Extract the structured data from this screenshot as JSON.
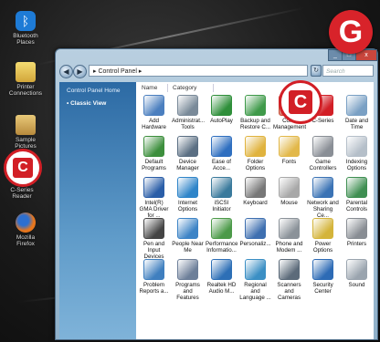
{
  "desktop": {
    "icons": [
      {
        "label": "Bluetooth Places",
        "color": "#1e7bd6"
      },
      {
        "label": "Printer Connections",
        "color": "#e2c048"
      },
      {
        "label": "Sample Pictures",
        "color": "#d7b25a"
      },
      {
        "label": "C-Series Reader",
        "color": "#d21f26"
      },
      {
        "label": "Mozilla Firefox",
        "color": "#e66a1a"
      }
    ]
  },
  "badge": {
    "letter": "G"
  },
  "window": {
    "address": "▸ Control Panel ▸",
    "search_placeholder": "Search",
    "controls": {
      "min": "_",
      "max": "□",
      "close": "x"
    },
    "sidebar": {
      "home": "Control Panel Home",
      "classic": "Classic View"
    },
    "columns": {
      "name": "Name",
      "category": "Category"
    },
    "items": [
      {
        "label": "Add Hardware",
        "color": "#4b7fbf",
        "icon": "hardware-icon"
      },
      {
        "label": "Administrat... Tools",
        "color": "#7a8a99",
        "icon": "admin-tools-icon"
      },
      {
        "label": "AutoPlay",
        "color": "#2f8f3a",
        "icon": "autoplay-icon"
      },
      {
        "label": "Backup and Restore C...",
        "color": "#3f9a4a",
        "icon": "backup-icon"
      },
      {
        "label": "Color Management",
        "color": "#c8503a",
        "icon": "color-management-icon"
      },
      {
        "label": "C-Series",
        "color": "#d21f26",
        "icon": "c-series-icon"
      },
      {
        "label": "Date and Time",
        "color": "#7aa0c4",
        "icon": "clock-icon"
      },
      {
        "label": "Default Programs",
        "color": "#3d8f3d",
        "icon": "default-programs-icon"
      },
      {
        "label": "Device Manager",
        "color": "#5b6f83",
        "icon": "device-manager-icon"
      },
      {
        "label": "Ease of Acce...",
        "color": "#2f6fc0",
        "icon": "ease-of-access-icon"
      },
      {
        "label": "Folder Options",
        "color": "#e0b33e",
        "icon": "folder-icon"
      },
      {
        "label": "Fonts",
        "color": "#e2b84a",
        "icon": "fonts-icon"
      },
      {
        "label": "Game Controllers",
        "color": "#8a8f96",
        "icon": "gamepad-icon"
      },
      {
        "label": "Indexing Options",
        "color": "#b5bfc9",
        "icon": "indexing-icon"
      },
      {
        "label": "Intel(R) GMA Driver for ...",
        "color": "#2a5ea8",
        "icon": "intel-icon"
      },
      {
        "label": "Internet Options",
        "color": "#2f85c9",
        "icon": "globe-icon"
      },
      {
        "label": "iSCSI Initiator",
        "color": "#3a7a9c",
        "icon": "iscsi-icon"
      },
      {
        "label": "Keyboard",
        "color": "#777",
        "icon": "keyboard-icon"
      },
      {
        "label": "Mouse",
        "color": "#a8a8a8",
        "icon": "mouse-icon"
      },
      {
        "label": "Network and Sharing Ce...",
        "color": "#3b73b5",
        "icon": "network-icon"
      },
      {
        "label": "Parental Controls",
        "color": "#3f8f52",
        "icon": "parental-icon"
      },
      {
        "label": "Pen and Input Devices",
        "color": "#444",
        "icon": "pen-icon"
      },
      {
        "label": "People Near Me",
        "color": "#3d84c6",
        "icon": "people-icon"
      },
      {
        "label": "Performance Informatio...",
        "color": "#4c9a49",
        "icon": "performance-icon"
      },
      {
        "label": "Personaliz...",
        "color": "#3e6fb0",
        "icon": "personalize-icon"
      },
      {
        "label": "Phone and Modem ...",
        "color": "#8b9299",
        "icon": "phone-icon"
      },
      {
        "label": "Power Options",
        "color": "#d4b43a",
        "icon": "power-icon"
      },
      {
        "label": "Printers",
        "color": "#888d93",
        "icon": "printer-icon"
      },
      {
        "label": "Problem Reports a...",
        "color": "#3f7fbf",
        "icon": "problem-reports-icon"
      },
      {
        "label": "Programs and Features",
        "color": "#6d7f99",
        "icon": "programs-icon"
      },
      {
        "label": "Realtek HD Audio M...",
        "color": "#2d6fb6",
        "icon": "audio-icon"
      },
      {
        "label": "Regional and Language ...",
        "color": "#3b8fc4",
        "icon": "regional-icon"
      },
      {
        "label": "Scanners and Cameras",
        "color": "#5c6b7a",
        "icon": "scanner-icon"
      },
      {
        "label": "Security Center",
        "color": "#2d6bb5",
        "icon": "shield-icon"
      },
      {
        "label": "Sound",
        "color": "#9aa4ae",
        "icon": "sound-icon"
      }
    ]
  }
}
